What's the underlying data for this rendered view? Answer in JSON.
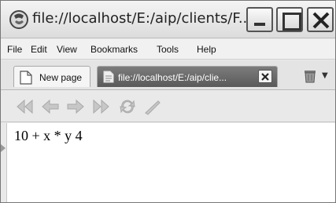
{
  "window": {
    "title": "file://localhost/E:/aip/clients/F..."
  },
  "menubar": {
    "items": [
      {
        "label": "File"
      },
      {
        "label": "Edit"
      },
      {
        "label": "View"
      },
      {
        "label": "Bookmarks"
      },
      {
        "label": "Tools"
      },
      {
        "label": "Help"
      }
    ]
  },
  "tabs": {
    "new_tab_label": "New page",
    "current_tab_label": "file://localhost/E:/aip/clie..."
  },
  "toolbar": {
    "icons": [
      "rewind-icon",
      "back-icon",
      "forward-icon",
      "fast-forward-icon",
      "reload-icon",
      "edit-icon"
    ]
  },
  "content": {
    "text": "10 + x * y 4"
  },
  "colors": {
    "active_tab": "#6a6a6a",
    "toolbar_icon_disabled": "#b8b8b8"
  }
}
